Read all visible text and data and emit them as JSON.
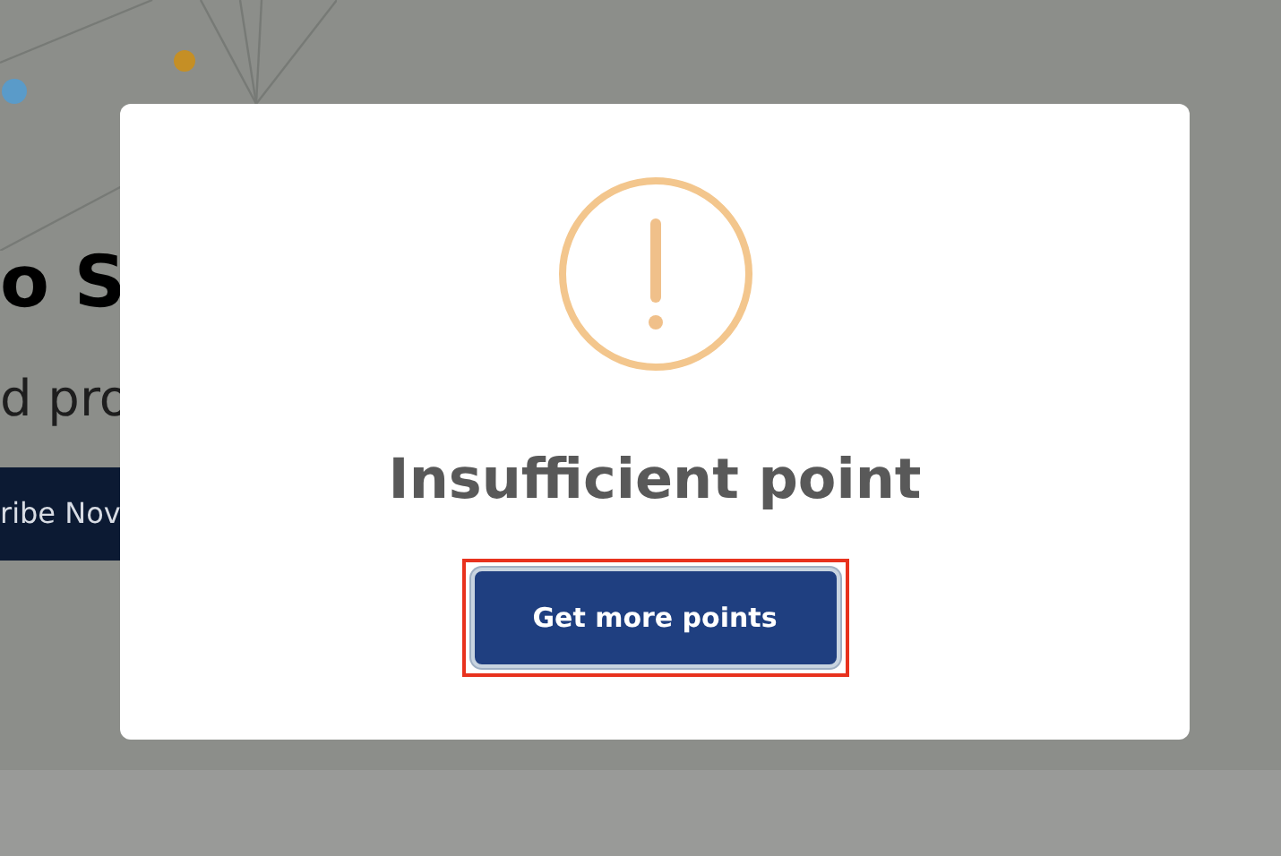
{
  "background_page": {
    "heading": "o S",
    "subtitle": "d pro",
    "button": "ribe Nov"
  },
  "dialog": {
    "title": "Insufficient point",
    "button": {
      "label": "Get more points",
      "highlighted": true
    }
  }
}
